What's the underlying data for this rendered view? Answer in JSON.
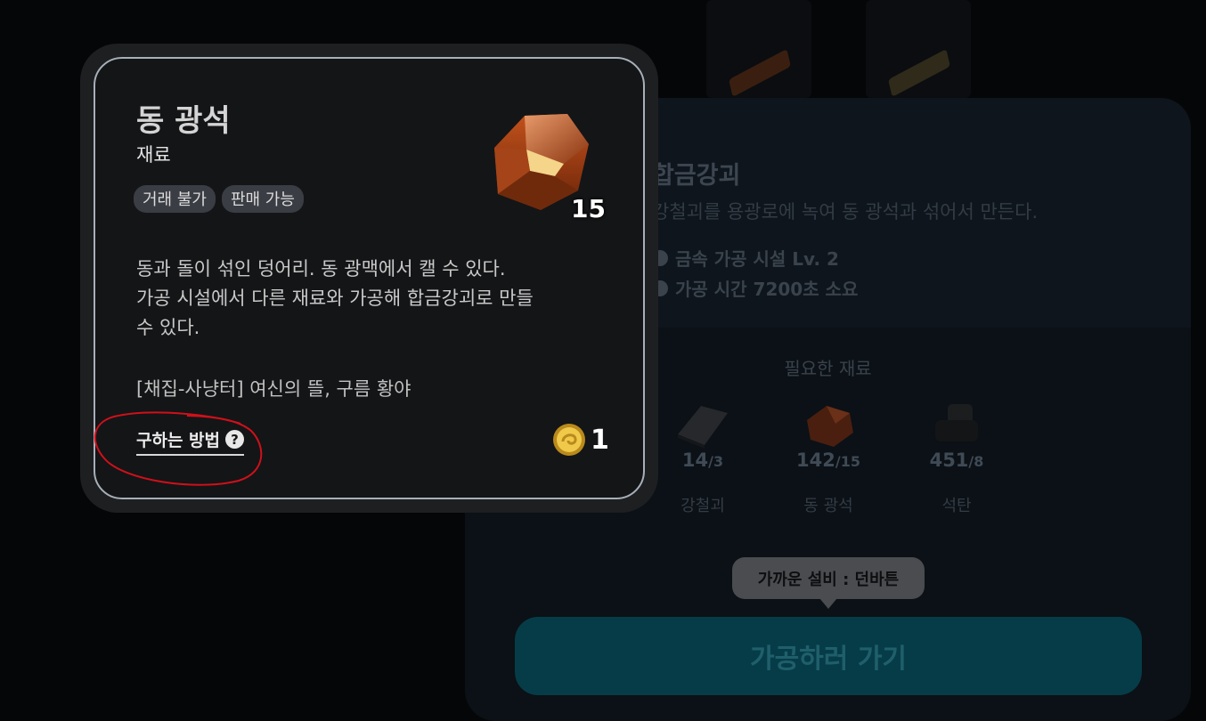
{
  "popup": {
    "item_name": "동 광석",
    "item_type": "재료",
    "tags": [
      "거래 불가",
      "판매 가능"
    ],
    "quantity": "15",
    "description": [
      "동과 돌이 섞인 덩어리. 동 광맥에서 캘 수 있다.",
      "가공 시설에서 다른 재료와 가공해 합금강괴로 만들",
      "수 있다."
    ],
    "source": "[채집-사냥터] 여신의 뜰, 구름 황야",
    "how_to_obtain": "구하는 방법",
    "help_glyph": "?",
    "price": "1",
    "icons": {
      "item": "copper-ore-icon",
      "currency": "gold-coin-icon",
      "help": "question-icon"
    }
  },
  "detail": {
    "title": "합금강괴",
    "description": "강철괴를 용광로에 녹여 동 광석과 섞어서 만든다.",
    "facility": "금속 가공 시설 Lv. 2",
    "time": "가공 시간 7200초 소요",
    "materials_heading": "필요한 재료",
    "materials": [
      {
        "name": "강철괴",
        "have": "14",
        "need": "/3",
        "icon": "steel-ingot-icon"
      },
      {
        "name": "동 광석",
        "have": "142",
        "need": "/15",
        "icon": "copper-ore-icon"
      },
      {
        "name": "석탄",
        "have": "451",
        "need": "/8",
        "icon": "coal-icon"
      }
    ],
    "tooltip": "가까운 설비 : 던바튼",
    "go_button": "가공하러 가기"
  },
  "colors": {
    "annotation": "#d0101a",
    "button": "#063c48",
    "card_border": "#a7afb9"
  }
}
